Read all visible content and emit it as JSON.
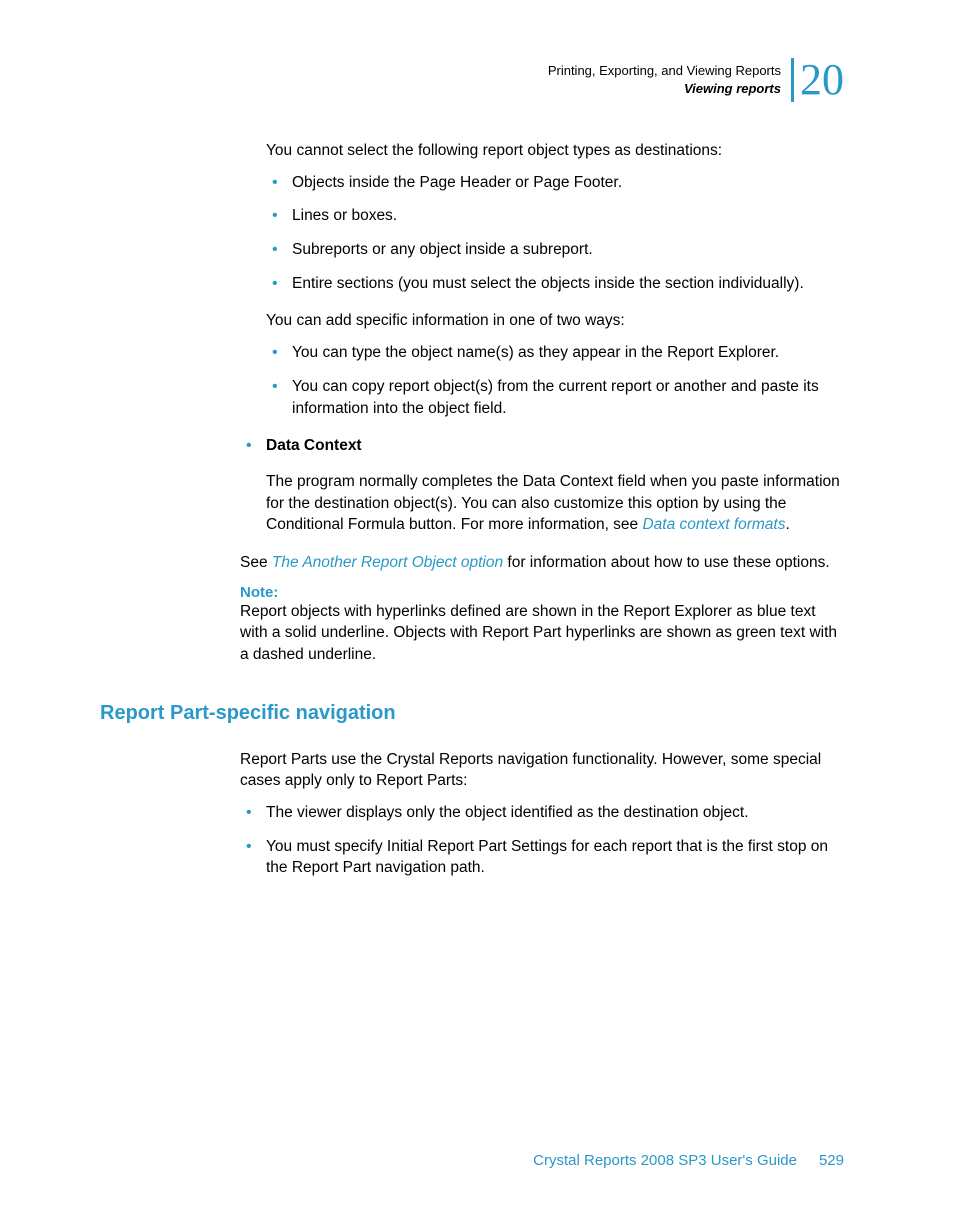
{
  "header": {
    "breadcrumb": "Printing, Exporting, and Viewing Reports",
    "section": "Viewing reports",
    "chapter": "20"
  },
  "intro": "You cannot select the following report object types as destinations:",
  "restrictions": [
    "Objects inside the Page Header or Page Footer.",
    "Lines or boxes.",
    "Subreports or any object inside a subreport.",
    "Entire sections (you must select the objects inside the section individually)."
  ],
  "ways_intro": "You can add specific information in one of two ways:",
  "ways": [
    "You can type the object name(s) as they appear in the Report Explorer.",
    "You can copy report object(s) from the current report or another and paste its information into the object field."
  ],
  "data_context": {
    "label": "Data Context",
    "body_pre": "The program normally completes the Data Context field when you paste information for the destination object(s). You can also customize this option by using the Conditional Formula button. For more information, see ",
    "link": "Data context formats",
    "body_post": "."
  },
  "see_also": {
    "pre": "See ",
    "link": "The Another Report Object option",
    "post": " for information about how to use these options."
  },
  "note": {
    "label": "Note:",
    "body": "Report objects with hyperlinks defined are shown in the Report Explorer as blue text with a solid underline. Objects with Report Part hyperlinks are shown as green text with a dashed underline."
  },
  "heading": "Report Part-specific navigation",
  "heading_intro": "Report Parts use the Crystal Reports navigation functionality. However, some special cases apply only to Report Parts:",
  "heading_bullets": [
    "The viewer displays only the object identified as the destination object.",
    "You must specify Initial Report Part Settings for each report that is the first stop on the Report Part navigation path."
  ],
  "footer": {
    "title": "Crystal Reports 2008 SP3 User's Guide",
    "page": "529"
  }
}
